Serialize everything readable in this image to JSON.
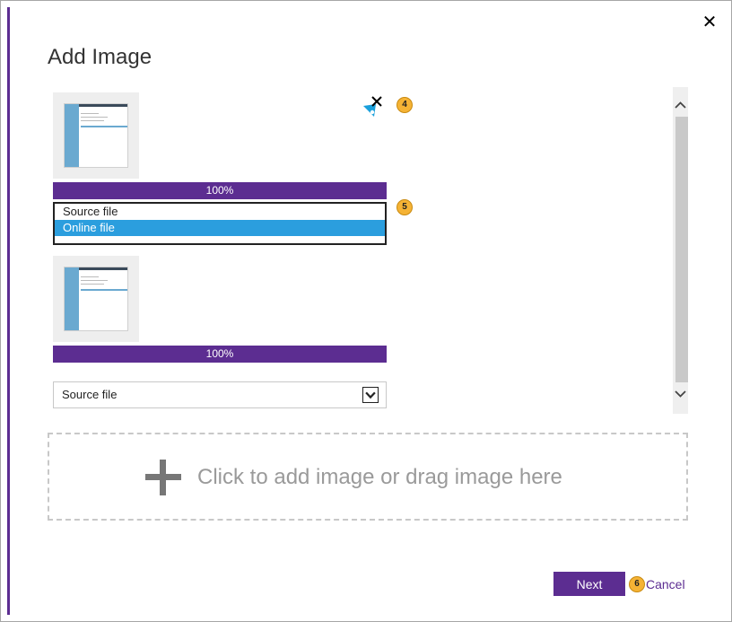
{
  "dialog": {
    "title": "Add Image",
    "close_glyph": "✕"
  },
  "items": [
    {
      "progress_label": "100%",
      "source_options": [
        "Source file",
        "Online file"
      ],
      "selected_option": "Online file"
    },
    {
      "progress_label": "100%",
      "source_value": "Source file"
    }
  ],
  "badges": {
    "remove": "4",
    "dropdown": "5",
    "actions": "6"
  },
  "dropzone": {
    "text": "Click to add image or drag image here"
  },
  "footer": {
    "next_label": "Next",
    "cancel_label": "Cancel"
  },
  "colors": {
    "accent": "#5c2d91",
    "selection": "#2b9ede",
    "badge": "#f5b335"
  }
}
